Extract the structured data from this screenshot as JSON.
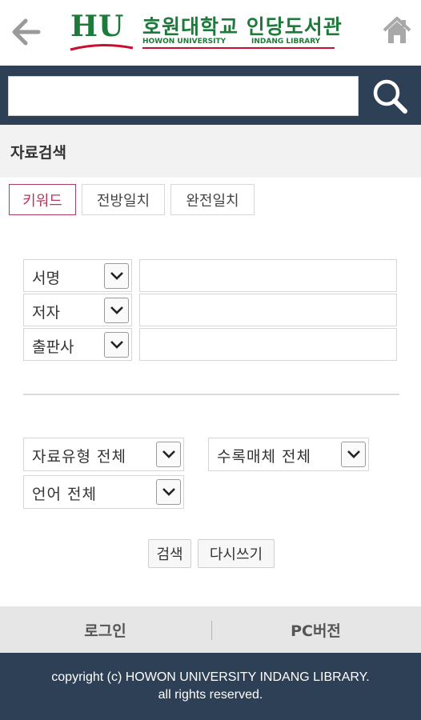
{
  "header": {
    "logo_mark": "HU",
    "logo_title": "호원대학교 인당도서관",
    "logo_sub_left": "HOWON UNIVERSITY",
    "logo_sub_right": "INDANG LIBRARY",
    "back_icon": "arrow-left-icon",
    "home_icon": "home-icon"
  },
  "search": {
    "value": "",
    "placeholder": "",
    "button_icon": "search-icon"
  },
  "section": {
    "title": "자료검색"
  },
  "tabs": [
    {
      "label": "키워드",
      "active": true
    },
    {
      "label": "전방일치",
      "active": false
    },
    {
      "label": "완전일치",
      "active": false
    }
  ],
  "fields": [
    {
      "select": "서명",
      "value": ""
    },
    {
      "select": "저자",
      "value": ""
    },
    {
      "select": "출판사",
      "value": ""
    }
  ],
  "filters": {
    "material_type": "자료유형 전체",
    "media_type": "수록매체 전체",
    "language": "언어 전체"
  },
  "actions": {
    "search_label": "검색",
    "reset_label": "다시쓰기"
  },
  "footer": {
    "login_label": "로그인",
    "pc_label": "PC버전",
    "copyright_line1": "copyright (c) HOWON UNIVERSITY INDANG LIBRARY.",
    "copyright_line2": "all rights reserved."
  },
  "colors": {
    "navy": "#2e4056",
    "brand_green": "#1d7a3a",
    "brand_red": "#c8102e",
    "active_tab": "#b03a5b"
  }
}
